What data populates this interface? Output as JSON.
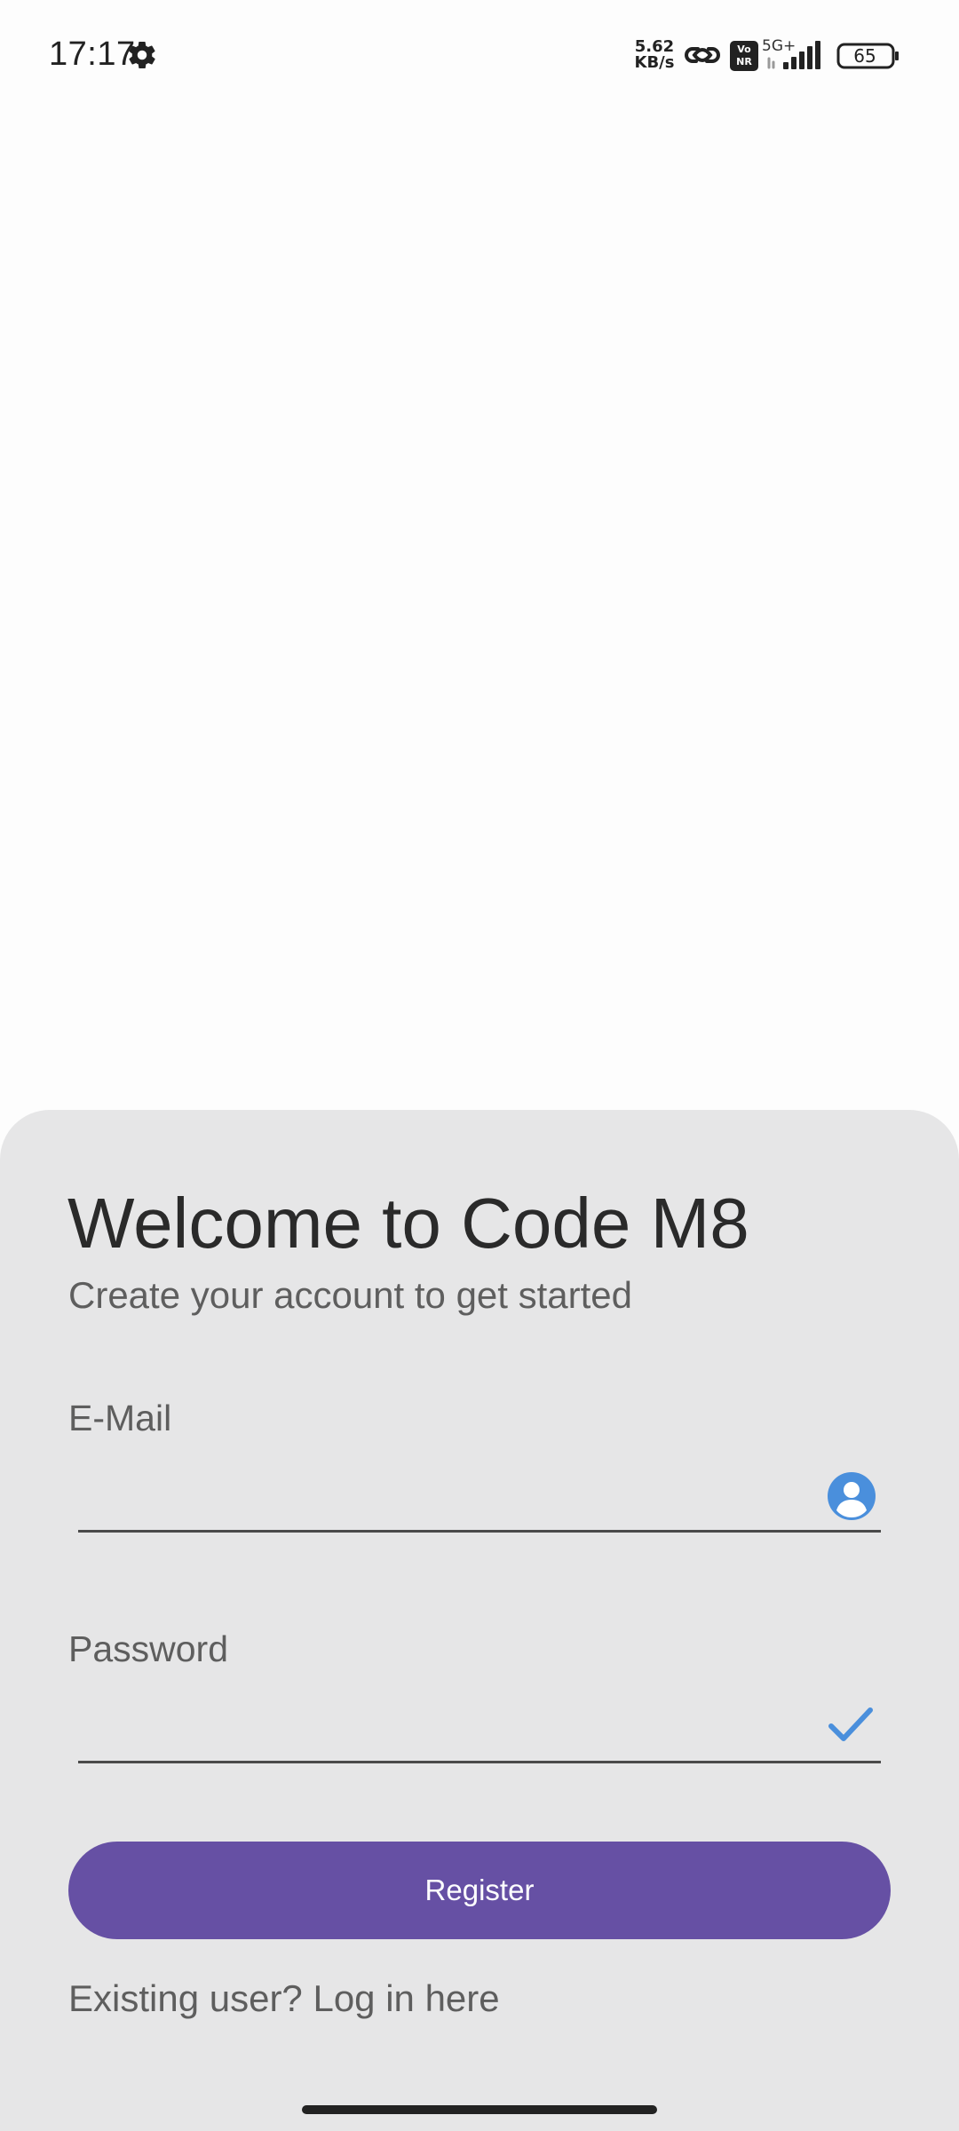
{
  "status_bar": {
    "time": "17:17",
    "settings_icon": "gear-icon",
    "net_speed_value": "5.62",
    "net_speed_unit": "KB/s",
    "hotspot_icon": "link-icon",
    "volte_top": "Vo",
    "volte_bottom": "NR",
    "network_type": "5G+",
    "signal_icon": "signal-bars-icon",
    "battery_level": "65"
  },
  "welcome": {
    "title": "Welcome to Code M8",
    "subtitle": "Create your account to get started"
  },
  "email": {
    "label": "E-Mail",
    "value": "",
    "placeholder": "",
    "icon": "account-circle-icon"
  },
  "password": {
    "label": "Password",
    "value": "",
    "placeholder": "",
    "icon": "check-icon"
  },
  "register_button": {
    "label": "Register"
  },
  "login_link": {
    "label": "Existing user? Log in here"
  },
  "colors": {
    "accent": "#6650a4",
    "icon_blue": "#4a8fdc",
    "sheet_background": "#e6e6e7",
    "page_background": "#fdfdfd"
  }
}
